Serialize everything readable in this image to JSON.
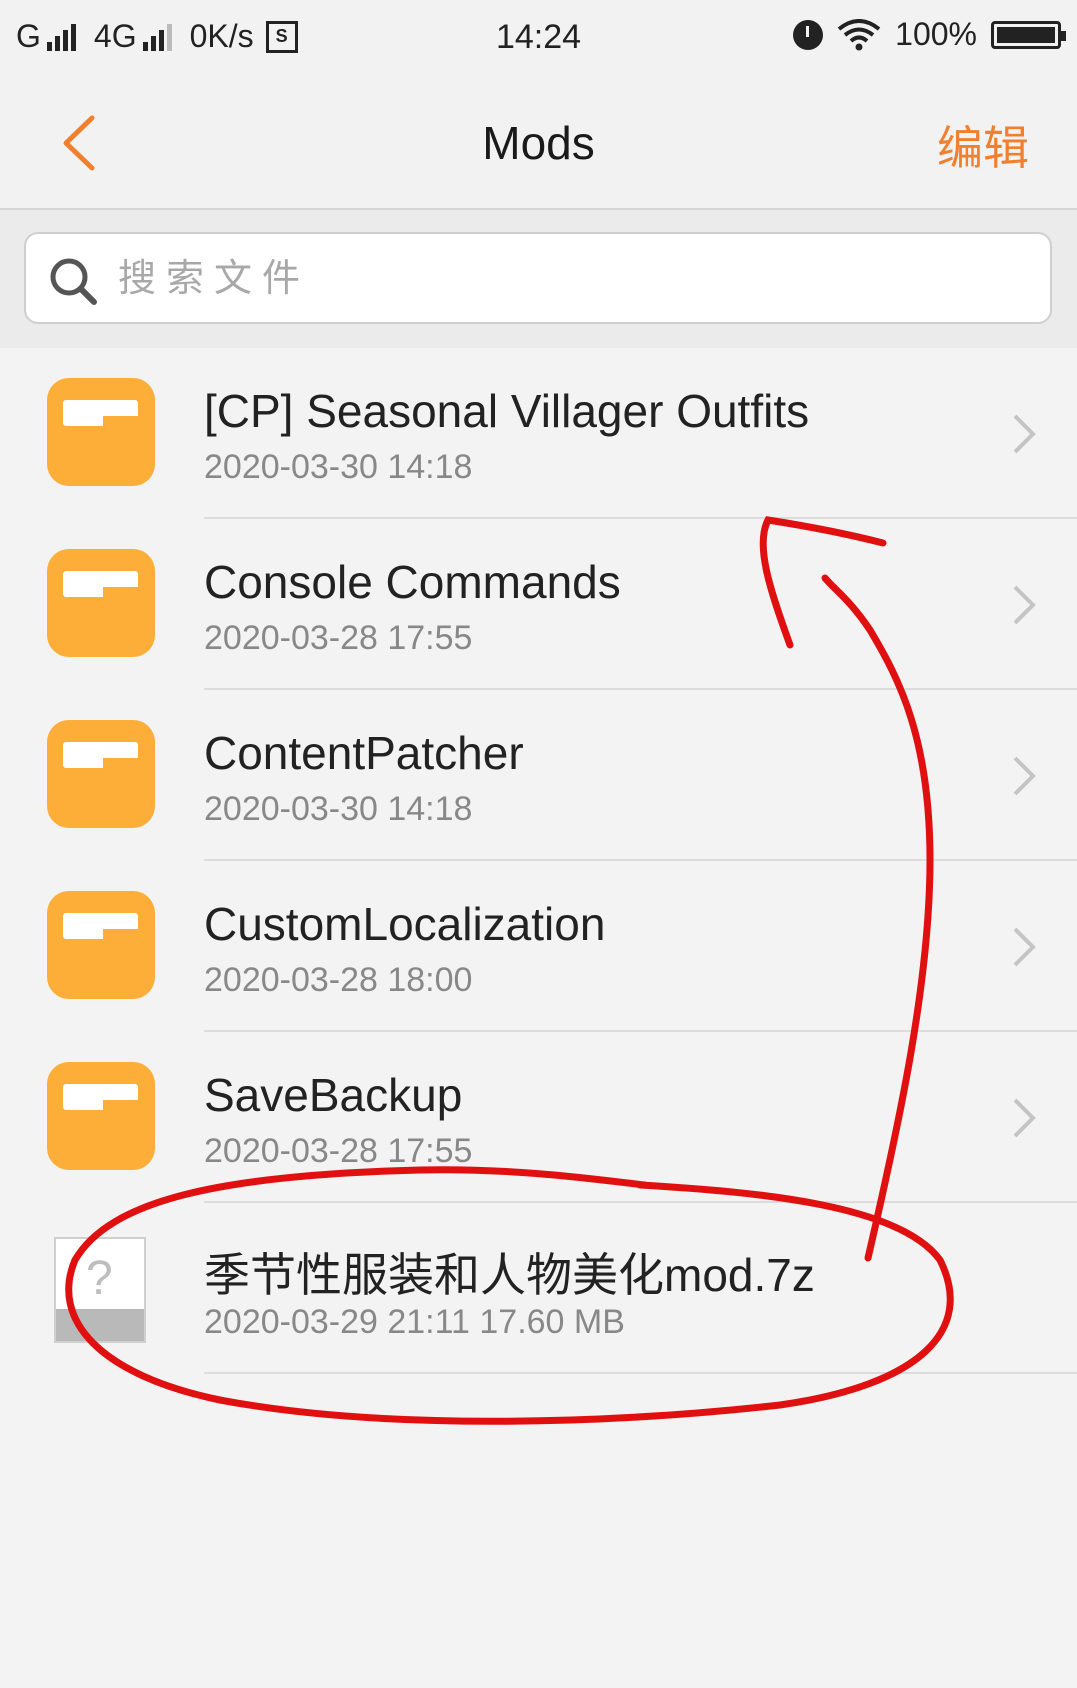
{
  "status_bar": {
    "carrier1": "G",
    "carrier2": "4G",
    "speed": "0K/s",
    "sim_label": "S",
    "time": "14:24",
    "battery": "100%",
    "battery_level": 1.0
  },
  "header": {
    "title": "Mods",
    "edit_label": "编辑"
  },
  "search": {
    "placeholder": "搜索文件"
  },
  "files": [
    {
      "name": "[CP] Seasonal Villager Outfits",
      "meta": "2020-03-30 14:18",
      "type": "folder"
    },
    {
      "name": "Console Commands",
      "meta": "2020-03-28 17:55",
      "type": "folder"
    },
    {
      "name": "ContentPatcher",
      "meta": "2020-03-30 14:18",
      "type": "folder"
    },
    {
      "name": "CustomLocalization",
      "meta": "2020-03-28 18:00",
      "type": "folder"
    },
    {
      "name": "SaveBackup",
      "meta": "2020-03-28 17:55",
      "type": "folder"
    },
    {
      "name": "季节性服装和人物美化mod.7z",
      "meta": "2020-03-29 21:11    17.60 MB",
      "type": "file",
      "icon": "unknown-file-icon"
    }
  ],
  "colors": {
    "accent": "#f07f2e",
    "folder": "#fdae38",
    "annotation": "#e01010"
  }
}
